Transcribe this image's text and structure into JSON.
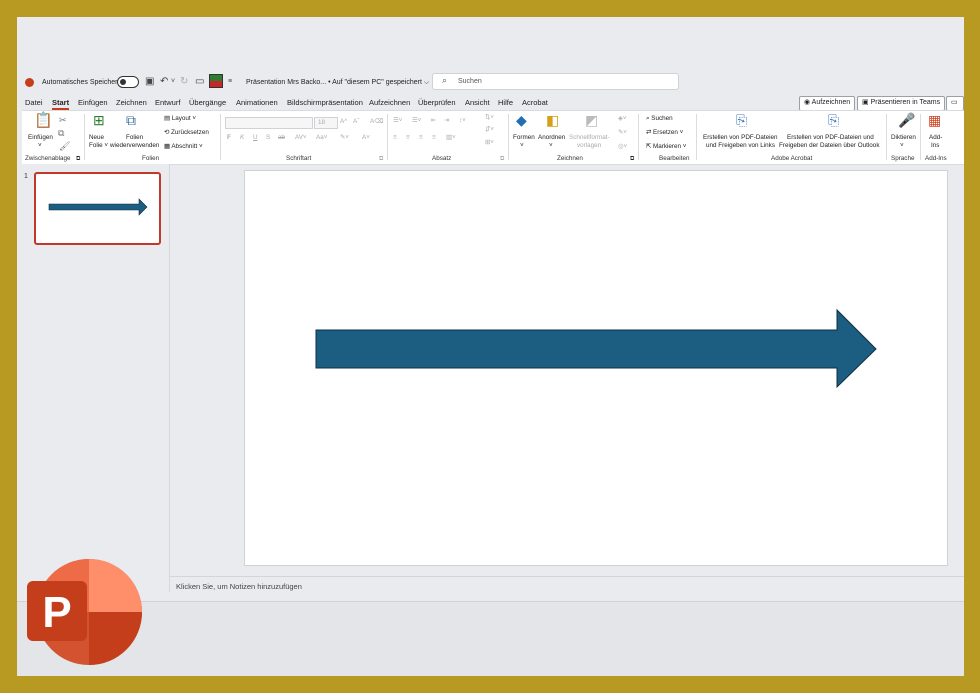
{
  "titlebar": {
    "autosave_label": "Automatisches Speichern",
    "doc_title": "Präsentation Mrs Backo... • Auf \"diesem PC\" gespeichert ⌵",
    "search_placeholder": "Suchen"
  },
  "tabs": [
    "Datei",
    "Start",
    "Einfügen",
    "Zeichnen",
    "Entwurf",
    "Übergänge",
    "Animationen",
    "Bildschirmpräsentation",
    "Aufzeichnen",
    "Überprüfen",
    "Ansicht",
    "Hilfe",
    "Acrobat"
  ],
  "active_tab": "Start",
  "right_buttons": {
    "record": "Aufzeichnen",
    "teams": "Präsentieren in Teams"
  },
  "ribbon": {
    "clipboard": {
      "paste": "Einfügen",
      "label": "Zwischenablage"
    },
    "slides": {
      "new_slide_1": "Neue",
      "new_slide_2": "Folie ˅",
      "reuse_1": "Folien",
      "reuse_2": "wiederverwenden",
      "layout": "Layout ˅",
      "reset": "Zurücksetzen",
      "section": "Abschnitt ˅",
      "label": "Folien"
    },
    "font": {
      "size": "18",
      "label": "Schriftart"
    },
    "paragraph": {
      "label": "Absatz"
    },
    "drawing": {
      "shapes": "Formen",
      "arrange": "Anordnen",
      "quick_1": "Schnellformat-",
      "quick_2": "vorlagen",
      "label": "Zeichnen"
    },
    "editing": {
      "find": "Suchen",
      "replace": "Ersetzen",
      "select": "Markieren",
      "label": "Bearbeiten"
    },
    "acrobat": {
      "a1_1": "Erstellen von PDF-Dateien",
      "a1_2": "und Freigeben von Links",
      "a2_1": "Erstellen von PDF-Dateien und",
      "a2_2": "Freigeben der Dateien über Outlook",
      "label": "Adobe Acrobat"
    },
    "voice": {
      "dictate": "Diktieren",
      "label": "Sprache"
    },
    "addins": {
      "add_1": "Add-",
      "add_2": "Ins",
      "label": "Add-Ins"
    }
  },
  "slide_panel": {
    "slide_number": "1"
  },
  "notes_placeholder": "Klicken Sie, um Notizen hinzuzufügen",
  "colors": {
    "arrow_fill": "#1b5e82",
    "accent": "#c43e1c",
    "frame": "#b89a22"
  }
}
